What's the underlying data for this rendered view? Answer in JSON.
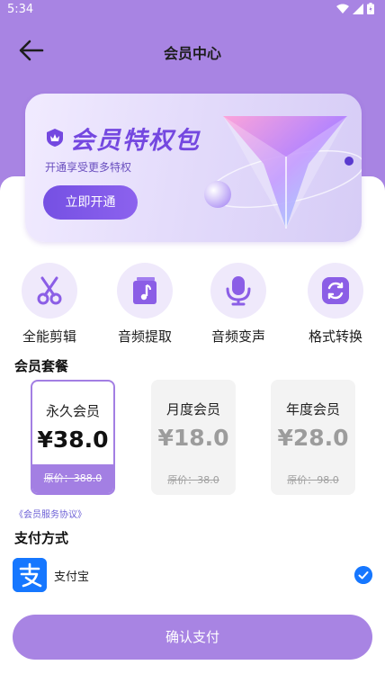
{
  "status_bar": {
    "time": "5:34"
  },
  "header": {
    "title": "会员中心"
  },
  "banner": {
    "title": "会员特权包",
    "subtitle": "开通享受更多特权",
    "open_button": "立即开通"
  },
  "features": [
    {
      "label": "全能剪辑",
      "icon": "scissors-icon"
    },
    {
      "label": "音频提取",
      "icon": "music-note-icon"
    },
    {
      "label": "音频变声",
      "icon": "microphone-icon"
    },
    {
      "label": "格式转换",
      "icon": "convert-icon"
    }
  ],
  "plans_section": {
    "title": "会员套餐"
  },
  "plans": [
    {
      "name": "永久会员",
      "price": "¥38.0",
      "original": "原价：388.0",
      "selected": true
    },
    {
      "name": "月度会员",
      "price": "¥18.0",
      "original": "原价：38.0",
      "selected": false
    },
    {
      "name": "年度会员",
      "price": "¥28.0",
      "original": "原价：98.0",
      "selected": false
    }
  ],
  "agreement_link": "《会员服务协议》",
  "payment": {
    "title": "支付方式",
    "method": "支付宝",
    "method_icon": "alipay-icon",
    "selected": true
  },
  "confirm_button": "确认支付",
  "colors": {
    "brand_purple": "#a884e3",
    "accent_purple": "#7550e3",
    "alipay_blue": "#1677ff"
  }
}
